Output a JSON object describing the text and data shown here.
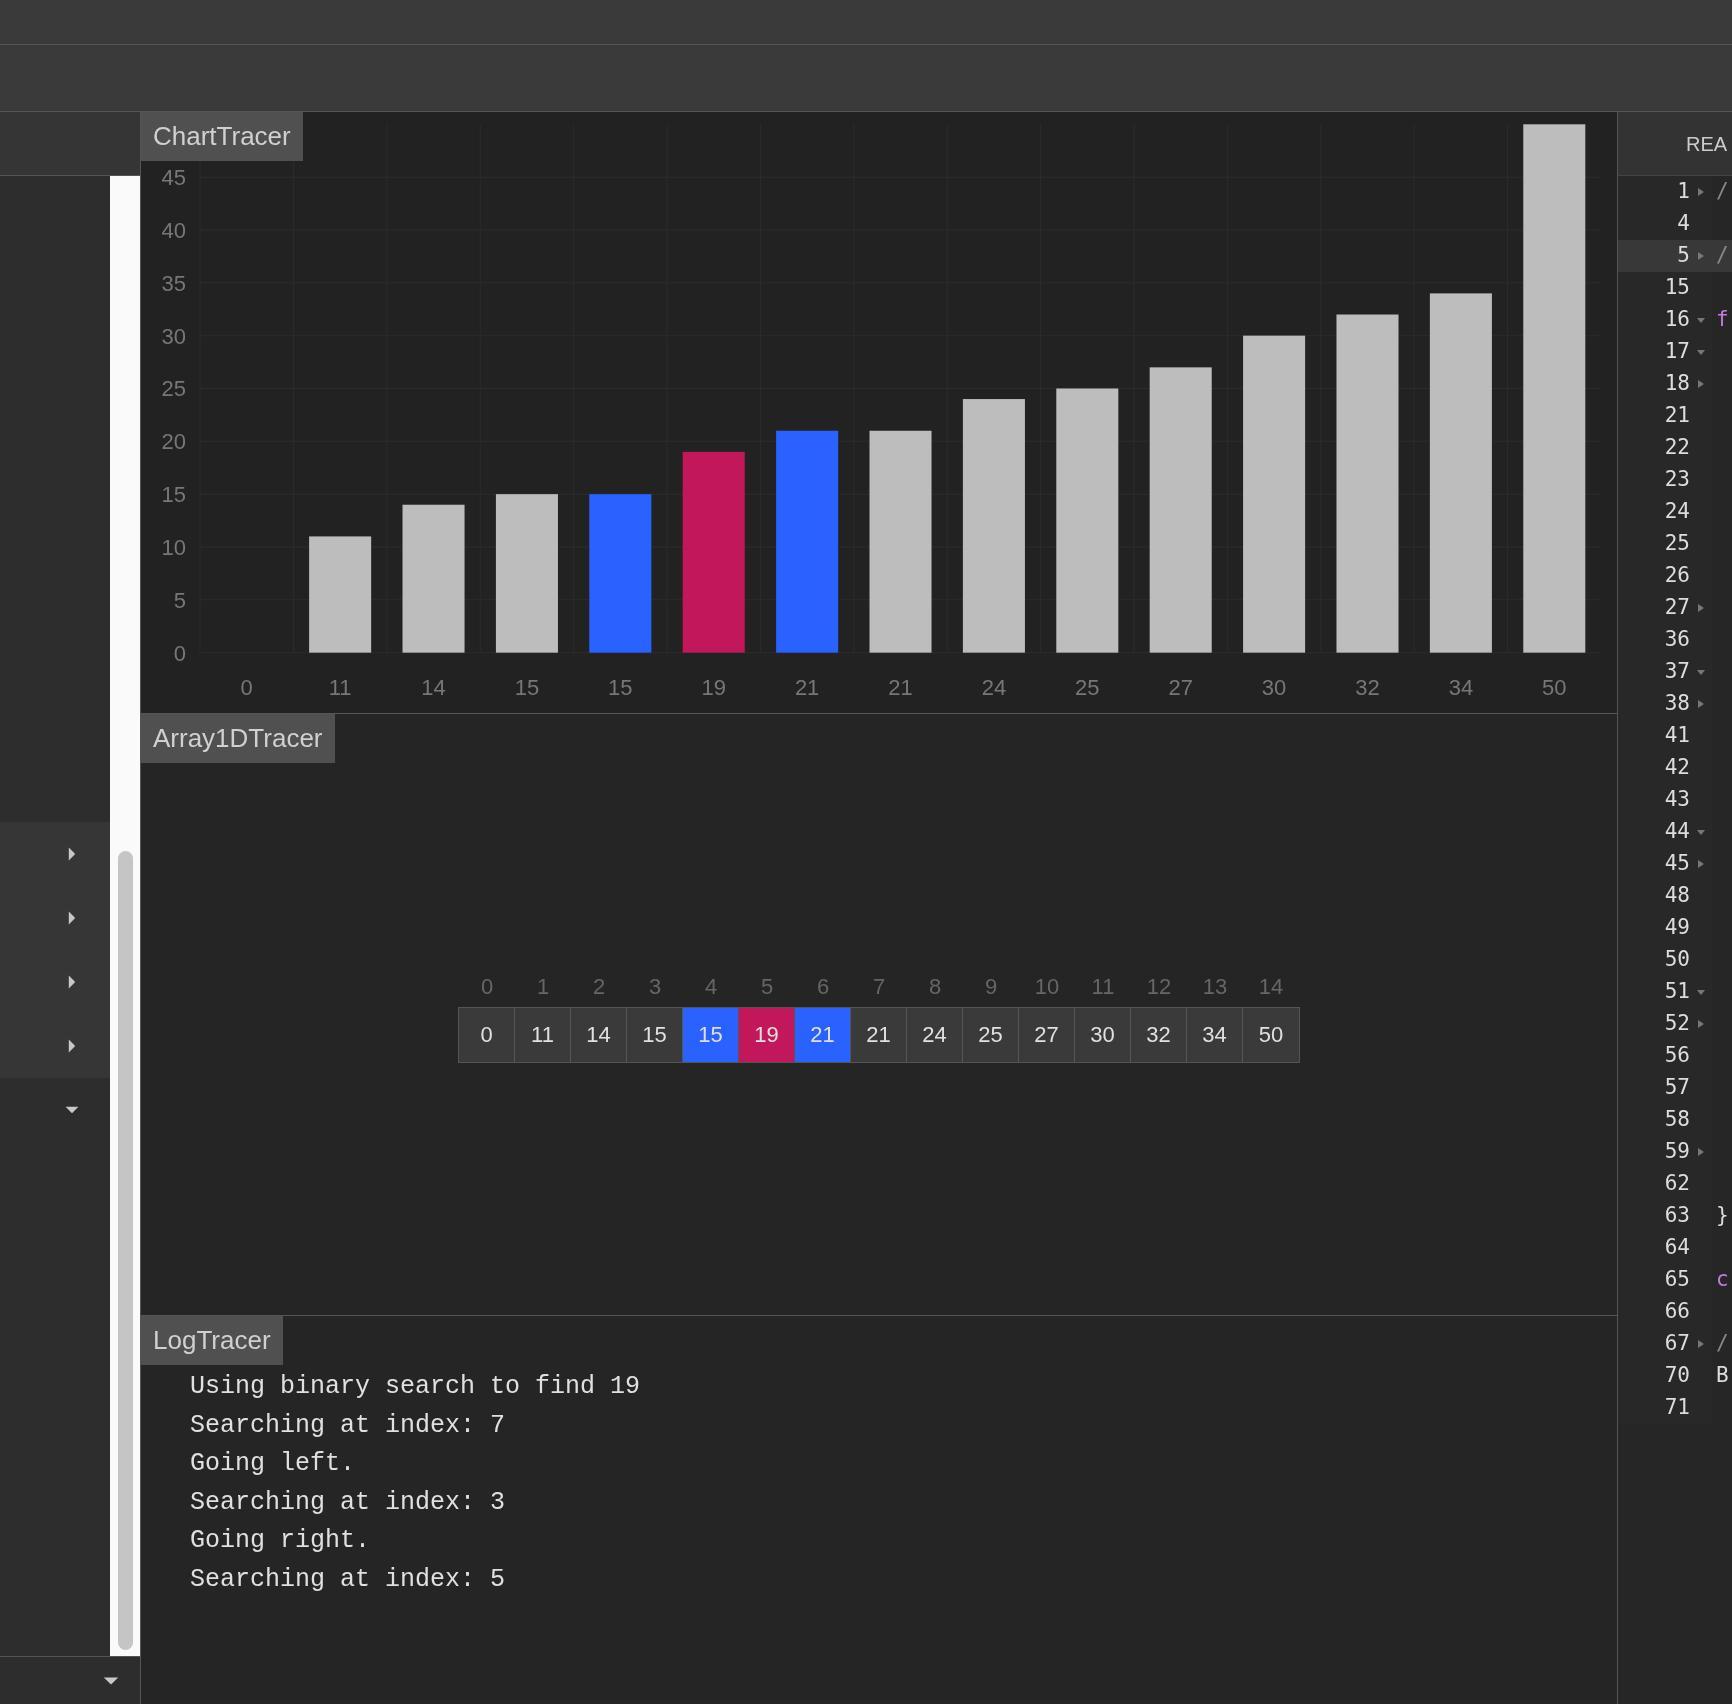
{
  "sidebar": {
    "group": [
      {
        "expanded": false
      },
      {
        "expanded": false
      },
      {
        "expanded": false
      },
      {
        "expanded": false
      }
    ],
    "items": [
      {
        "expanded": true
      }
    ],
    "footer": {
      "expanded": true
    }
  },
  "chart_panel": {
    "title": "ChartTracer",
    "chart_data": {
      "type": "bar",
      "grid": true,
      "stacked": true,
      "categories": [
        "0",
        "11",
        "14",
        "15",
        "15",
        "19",
        "21",
        "21",
        "24",
        "25",
        "27",
        "30",
        "32",
        "34",
        "50"
      ],
      "series": [
        {
          "color": "#bdbdbd",
          "values": [
            0,
            11,
            14,
            15,
            null,
            null,
            null,
            21,
            24,
            25,
            27,
            30,
            32,
            34,
            50
          ]
        },
        {
          "color": "#2962ff",
          "values": [
            null,
            null,
            null,
            null,
            15,
            null,
            21,
            null,
            null,
            null,
            null,
            null,
            null,
            null,
            null
          ]
        },
        {
          "color": "#c2185b",
          "values": [
            null,
            null,
            null,
            null,
            null,
            19,
            null,
            null,
            null,
            null,
            null,
            null,
            null,
            null,
            null
          ]
        }
      ],
      "ylim": [
        0,
        50
      ],
      "yticks": [
        0,
        5,
        10,
        15,
        20,
        25,
        30,
        35,
        40,
        45
      ]
    }
  },
  "array_panel": {
    "title": "Array1DTracer",
    "cells": [
      {
        "index": "0",
        "value": "0",
        "color": "#3a3a3a"
      },
      {
        "index": "1",
        "value": "11",
        "color": "#3a3a3a"
      },
      {
        "index": "2",
        "value": "14",
        "color": "#3a3a3a"
      },
      {
        "index": "3",
        "value": "15",
        "color": "#3a3a3a"
      },
      {
        "index": "4",
        "value": "15",
        "color": "#2962ff"
      },
      {
        "index": "5",
        "value": "19",
        "color": "#c2185b"
      },
      {
        "index": "6",
        "value": "21",
        "color": "#2962ff"
      },
      {
        "index": "7",
        "value": "21",
        "color": "#3a3a3a"
      },
      {
        "index": "8",
        "value": "24",
        "color": "#3a3a3a"
      },
      {
        "index": "9",
        "value": "25",
        "color": "#3a3a3a"
      },
      {
        "index": "10",
        "value": "27",
        "color": "#3a3a3a"
      },
      {
        "index": "11",
        "value": "30",
        "color": "#3a3a3a"
      },
      {
        "index": "12",
        "value": "32",
        "color": "#3a3a3a"
      },
      {
        "index": "13",
        "value": "34",
        "color": "#3a3a3a"
      },
      {
        "index": "14",
        "value": "50",
        "color": "#3a3a3a"
      }
    ]
  },
  "log_panel": {
    "title": "LogTracer",
    "lines": [
      "Using binary search to find 19",
      "Searching at index: 7",
      "Going left.",
      "Searching at index: 3",
      "Going right.",
      "Searching at index: 5"
    ]
  },
  "editor": {
    "tab": "REA",
    "lines": [
      {
        "number": "1",
        "kind": "right",
        "highlighted": false,
        "code": {
          "text": "/",
          "kind": "comment"
        }
      },
      {
        "number": "4",
        "kind": "none",
        "highlighted": false
      },
      {
        "number": "5",
        "kind": "right",
        "highlighted": true,
        "code": {
          "text": "/",
          "kind": "comment"
        }
      },
      {
        "number": "15",
        "kind": "none",
        "highlighted": false
      },
      {
        "number": "16",
        "kind": "down",
        "highlighted": false,
        "code": {
          "text": "f",
          "kind": "keyword"
        }
      },
      {
        "number": "17",
        "kind": "down",
        "highlighted": false
      },
      {
        "number": "18",
        "kind": "right",
        "highlighted": false
      },
      {
        "number": "21",
        "kind": "none",
        "highlighted": false
      },
      {
        "number": "22",
        "kind": "none",
        "highlighted": false
      },
      {
        "number": "23",
        "kind": "none",
        "highlighted": false
      },
      {
        "number": "24",
        "kind": "none",
        "highlighted": false
      },
      {
        "number": "25",
        "kind": "none",
        "highlighted": false
      },
      {
        "number": "26",
        "kind": "none",
        "highlighted": false
      },
      {
        "number": "27",
        "kind": "right",
        "highlighted": false
      },
      {
        "number": "36",
        "kind": "none",
        "highlighted": false
      },
      {
        "number": "37",
        "kind": "down",
        "highlighted": false
      },
      {
        "number": "38",
        "kind": "right",
        "highlighted": false
      },
      {
        "number": "41",
        "kind": "none",
        "highlighted": false
      },
      {
        "number": "42",
        "kind": "none",
        "highlighted": false
      },
      {
        "number": "43",
        "kind": "none",
        "highlighted": false
      },
      {
        "number": "44",
        "kind": "down",
        "highlighted": false
      },
      {
        "number": "45",
        "kind": "right",
        "highlighted": false
      },
      {
        "number": "48",
        "kind": "none",
        "highlighted": false
      },
      {
        "number": "49",
        "kind": "none",
        "highlighted": false
      },
      {
        "number": "50",
        "kind": "none",
        "highlighted": false
      },
      {
        "number": "51",
        "kind": "down",
        "highlighted": false
      },
      {
        "number": "52",
        "kind": "right",
        "highlighted": false
      },
      {
        "number": "56",
        "kind": "none",
        "highlighted": false
      },
      {
        "number": "57",
        "kind": "none",
        "highlighted": false
      },
      {
        "number": "58",
        "kind": "none",
        "highlighted": false
      },
      {
        "number": "59",
        "kind": "right",
        "highlighted": false
      },
      {
        "number": "62",
        "kind": "none",
        "highlighted": false
      },
      {
        "number": "63",
        "kind": "none",
        "highlighted": false,
        "code": {
          "text": "}",
          "kind": "plain"
        }
      },
      {
        "number": "64",
        "kind": "none",
        "highlighted": false
      },
      {
        "number": "65",
        "kind": "none",
        "highlighted": false,
        "code": {
          "text": "c",
          "kind": "keyword"
        }
      },
      {
        "number": "66",
        "kind": "none",
        "highlighted": false
      },
      {
        "number": "67",
        "kind": "right",
        "highlighted": false,
        "code": {
          "text": "/",
          "kind": "comment"
        }
      },
      {
        "number": "70",
        "kind": "none",
        "highlighted": false,
        "code": {
          "text": "B",
          "kind": "plain"
        }
      },
      {
        "number": "71",
        "kind": "none",
        "highlighted": false
      }
    ]
  }
}
